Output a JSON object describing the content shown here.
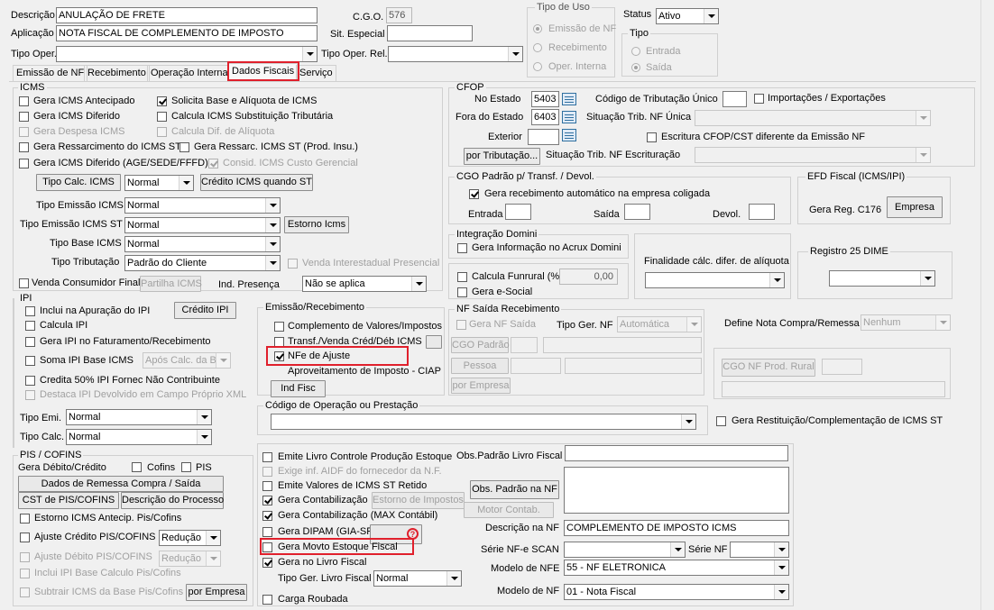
{
  "header": {
    "descricao_label": "Descrição",
    "descricao_value": "ANULAÇÃO DE FRETE",
    "cgo_label": "C.G.O.",
    "cgo_value": "576",
    "aplicacao_label": "Aplicação",
    "aplicacao_value": "NOTA FISCAL DE COMPLEMENTO DE IMPOSTO",
    "sit_especial_label": "Sit. Especial",
    "tipo_oper_label": "Tipo Oper.",
    "tipo_oper_rel_label": "Tipo Oper. Rel.",
    "tipo_uso_title": "Tipo de Uso",
    "tipo_uso_options": [
      "Emissão de NF",
      "Recebimento",
      "Oper. Interna"
    ],
    "status_label": "Status",
    "status_value": "Ativo",
    "tipo_title": "Tipo",
    "tipo_options": [
      "Entrada",
      "Saída"
    ]
  },
  "tabs": [
    "Emissão de NF",
    "Recebimento",
    "Operação Interna",
    "Dados Fiscais",
    "Serviço"
  ],
  "icms": {
    "title": "ICMS",
    "cb": [
      "Gera ICMS Antecipado",
      "Solicita Base e Alíquota de ICMS",
      "Gera ICMS Diferido",
      "Calcula ICMS Substituição Tributária",
      "Gera Despesa ICMS",
      "Calcula Dif. de Alíquota",
      "Gera Ressarcimento do ICMS ST",
      "Gera Ressarc. ICMS ST (Prod. Insu.)",
      "Gera ICMS Diferido (AGE/SEDE/FFFD)",
      "Consid. ICMS Custo Gerencial"
    ],
    "tipo_calc_btn": "Tipo Calc. ICMS",
    "tipo_calc_value": "Normal",
    "credito_st_btn": "Crédito ICMS quando ST",
    "tipo_emissao_label": "Tipo Emissão ICMS",
    "tipo_emissao_value": "Normal",
    "tipo_emissao_st_label": "Tipo Emissão ICMS ST",
    "tipo_emissao_st_value": "Normal",
    "estorno_btn": "Estorno Icms",
    "tipo_base_label": "Tipo Base ICMS",
    "tipo_base_value": "Normal",
    "tipo_trib_label": "Tipo Tributação",
    "tipo_trib_value": "Padrão do Cliente",
    "venda_inter_label": "Venda Interestadual Presencial",
    "venda_consumidor_label": "Venda Consumidor Final",
    "partilha_btn": "Partilha ICMS",
    "ind_presenca_label": "Ind. Presença",
    "ind_presenca_value": "Não se aplica"
  },
  "ipi": {
    "title": "IPI",
    "cb": [
      "Inclui na Apuração do IPI",
      "Calcula IPI",
      "Gera IPI no Faturamento/Recebimento",
      "Soma IPI Base ICMS",
      "Credita 50% IPI Fornec Não Contribuinte",
      "Destaca IPI Devolvido em Campo Próprio XML"
    ],
    "credito_btn": "Crédito IPI",
    "apos_calc_value": "Após Calc. da Base",
    "tipo_emi_label": "Tipo Emi.",
    "tipo_emi_value": "Normal",
    "tipo_calc_label": "Tipo Calc.",
    "tipo_calc_value": "Normal"
  },
  "pis": {
    "title": "PIS / COFINS",
    "gera_label": "Gera Débito/Crédito",
    "cofins_label": "Cofins",
    "pis_label": "PIS",
    "remessa_btn": "Dados de Remessa Compra / Saída",
    "cst_btn": "CST de PIS/COFINS",
    "descricao_btn": "Descrição do Processo",
    "cb": [
      "Estorno ICMS Antecip. Pis/Cofins",
      "Ajuste Crédito PIS/COFINS",
      "Ajuste Débito PIS/COFINS",
      "Inclui IPI Base Calculo Pis/Cofins",
      "Subtrair ICMS da Base Pis/Cofins"
    ],
    "reducao_1": "Redução",
    "reducao_2": "Redução",
    "por_empresa_btn": "por Empresa"
  },
  "cfop": {
    "title": "CFOP",
    "no_estado_label": "No Estado",
    "no_estado_value": "5403",
    "fora_estado_label": "Fora do Estado",
    "fora_estado_value": "6403",
    "exterior_label": "Exterior",
    "por_trib_btn": "por Tributação...",
    "cod_trib_label": "Código de Tributação Único",
    "import_label": "Importações / Exportações",
    "sit_trib_label": "Situação Trib. NF Única",
    "escritura_label": "Escritura CFOP/CST diferente da Emissão NF",
    "sit_trib_esc_label": "Situação Trib. NF Escrituração"
  },
  "cgo_padrao": {
    "title": "CGO Padrão p/ Transf. / Devol.",
    "gera_label": "Gera recebimento automático na empresa coligada",
    "entrada_label": "Entrada",
    "saida_label": "Saída",
    "devol_label": "Devol."
  },
  "efd": {
    "title": "EFD Fiscal (ICMS/IPI)",
    "gera_label": "Gera Reg. C176",
    "empresa_btn": "Empresa"
  },
  "integracao": {
    "title": "Integração Domini",
    "gera_label": "Gera Informação no Acrux Domini"
  },
  "finalidade": {
    "label": "Finalidade cálc. difer. de alíquota"
  },
  "registro25": {
    "title": "Registro 25 DIME"
  },
  "funrural": {
    "calcula_label": "Calcula Funrural (%)",
    "value": "0,00",
    "esocial_label": "Gera e-Social"
  },
  "emissao_rec": {
    "title": "Emissão/Recebimento",
    "cb": [
      "Complemento de Valores/Impostos",
      "Transf./Venda Créd/Déb ICMS",
      "NFe de Ajuste"
    ],
    "aproveitamento_label": "Aproveitamento de Imposto - CIAP",
    "ind_fisc_btn": "Ind Fisc"
  },
  "nf_saida": {
    "title": "NF Saída Recebimento",
    "gera_label": "Gera NF Saída",
    "tipo_ger_label": "Tipo Ger. NF",
    "tipo_ger_value": "Automática",
    "cgo_padrao_btn": "CGO Padrão",
    "pessoa_btn": "Pessoa",
    "por_empresa_btn": "por Empresa"
  },
  "define_nota": {
    "label": "Define Nota Compra/Remessa",
    "value": "Nenhum"
  },
  "cgo_nf_prod": {
    "btn": "CGO NF Prod. Rural"
  },
  "cod_operacao": {
    "title": "Código de Operação ou Prestação"
  },
  "gera_restituicao_label": "Gera Restituição/Complementação de ICMS ST",
  "bottom": {
    "cb": [
      "Emite Livro Controle Produção Estoque",
      "Exige inf. AIDF do fornecedor da N.F.",
      "Emite Valores de ICMS ST Retido",
      "Gera Contabilização",
      "Gera Contabilização (MAX Contábil)",
      "Gera DIPAM (GIA-SP)",
      "Gera Movto Estoque Fiscal",
      "Gera no Livro Fiscal",
      "Carga Roubada"
    ],
    "estorno_impostos_btn": "Estorno de Impostos",
    "tipo_ger_livro_label": "Tipo Ger. Livro Fiscal",
    "tipo_ger_livro_value": "Normal",
    "obs_padrao_label": "Obs.Padrão Livro Fiscal",
    "obs_padrao_nf_btn": "Obs. Padrão na NF",
    "motor_contab_btn": "Motor Contab.",
    "descricao_nf_label": "Descrição na NF",
    "descricao_nf_value": "COMPLEMENTO DE IMPOSTO ICMS",
    "serie_scan_label": "Série NF-e SCAN",
    "serie_nf_label": "Série NF",
    "modelo_nfe_label": "Modelo de NFE",
    "modelo_nfe_value": "55 - NF ELETRONICA",
    "modelo_nf_label": "Modelo de NF",
    "modelo_nf_value": "01 - Nota Fiscal",
    "help_symbol": "?"
  },
  "colors": {
    "highlight": "#e0202c",
    "window_bg": "#f0f0f0"
  }
}
